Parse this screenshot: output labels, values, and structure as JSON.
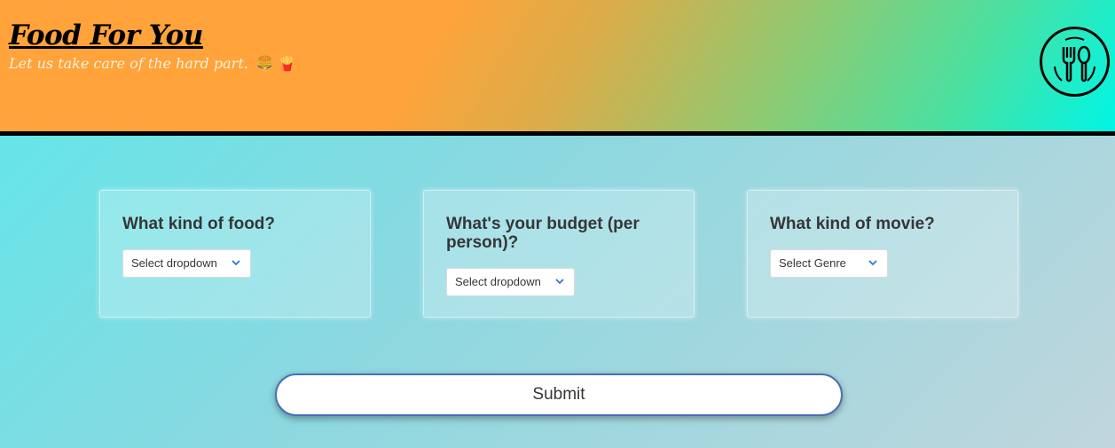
{
  "header": {
    "title": "Food For You",
    "tagline": "Let us take care of the hard part.",
    "tagline_emojis": "🍔 🍟",
    "logo_icon": "fork-spoon-icon"
  },
  "questions": [
    {
      "label": "What kind of food?",
      "select_value": "Select dropdown"
    },
    {
      "label": "What's your budget (per person)?",
      "select_value": "Select dropdown"
    },
    {
      "label": "What kind of movie?",
      "select_value": "Select Genre"
    }
  ],
  "submit_label": "Submit",
  "colors": {
    "header_orange": "#ffa33a",
    "header_cyan": "#00f5e6",
    "select_chevron": "#3273dc",
    "submit_border": "#4a6fb8"
  }
}
